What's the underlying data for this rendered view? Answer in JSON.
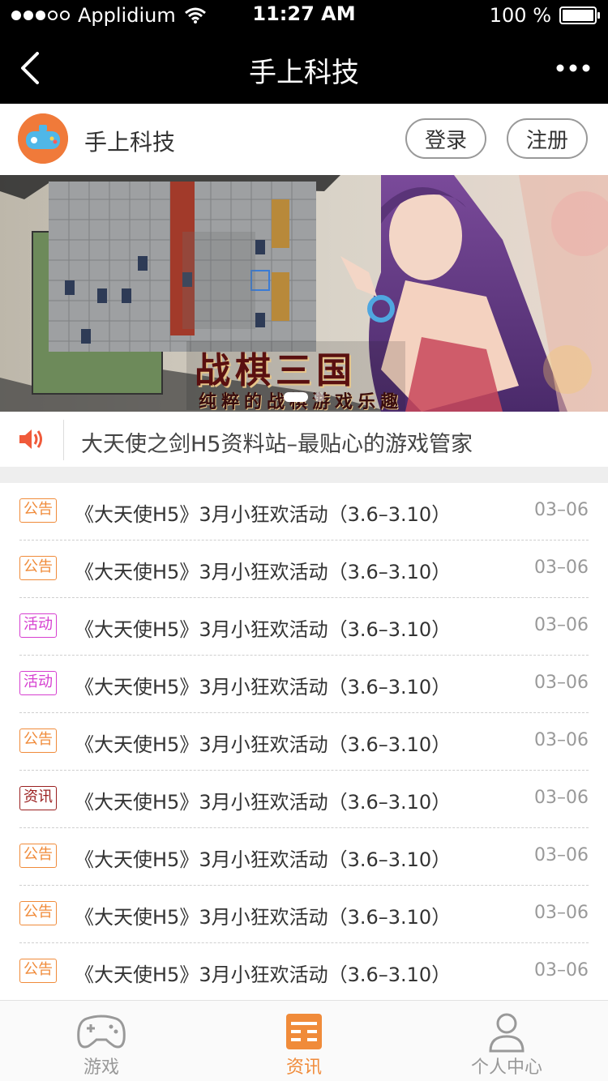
{
  "status_bar": {
    "carrier": "Applidium",
    "time": "11:27 AM",
    "battery": "100 %",
    "signal_filled": 3,
    "signal_total": 5
  },
  "nav": {
    "title": "手上科技",
    "back_icon": "chevron-left-icon",
    "more_icon": "more-dots-icon"
  },
  "header": {
    "avatar_icon": "gamepad-logo",
    "brand": "手上科技",
    "login_label": "登录",
    "register_label": "注册"
  },
  "banner": {
    "title": "战棋三国",
    "subtitle": "纯粹的战棋游戏乐趣",
    "pages": 2,
    "active_page": 1
  },
  "notice": {
    "icon": "speaker-icon",
    "text": "大天使之剑H5资料站–最贴心的游戏管家"
  },
  "news": [
    {
      "tag": "公告",
      "tag_color": "#f08b3a",
      "title": "《大天使H5》3月小狂欢活动（3.6–3.10）",
      "date": "03–06"
    },
    {
      "tag": "公告",
      "tag_color": "#f08b3a",
      "title": "《大天使H5》3月小狂欢活动（3.6–3.10）",
      "date": "03–06"
    },
    {
      "tag": "活动",
      "tag_color": "#d63fd0",
      "title": "《大天使H5》3月小狂欢活动（3.6–3.10）",
      "date": "03–06"
    },
    {
      "tag": "活动",
      "tag_color": "#d63fd0",
      "title": "《大天使H5》3月小狂欢活动（3.6–3.10）",
      "date": "03–06"
    },
    {
      "tag": "公告",
      "tag_color": "#f08b3a",
      "title": "《大天使H5》3月小狂欢活动（3.6–3.10）",
      "date": "03–06"
    },
    {
      "tag": "资讯",
      "tag_color": "#9a1f1f",
      "title": "《大天使H5》3月小狂欢活动（3.6–3.10）",
      "date": "03–06"
    },
    {
      "tag": "公告",
      "tag_color": "#f08b3a",
      "title": "《大天使H5》3月小狂欢活动（3.6–3.10）",
      "date": "03–06"
    },
    {
      "tag": "公告",
      "tag_color": "#f08b3a",
      "title": "《大天使H5》3月小狂欢活动（3.6–3.10）",
      "date": "03–06"
    },
    {
      "tag": "公告",
      "tag_color": "#f08b3a",
      "title": "《大天使H5》3月小狂欢活动（3.6–3.10）",
      "date": "03–06"
    }
  ],
  "tabs": [
    {
      "label": "游戏",
      "icon": "gamepad-icon",
      "active": false
    },
    {
      "label": "资讯",
      "icon": "news-icon",
      "active": true
    },
    {
      "label": "个人中心",
      "icon": "user-icon",
      "active": false
    }
  ],
  "colors": {
    "accent": "#f08b3a",
    "bar_bg": "#000000"
  }
}
